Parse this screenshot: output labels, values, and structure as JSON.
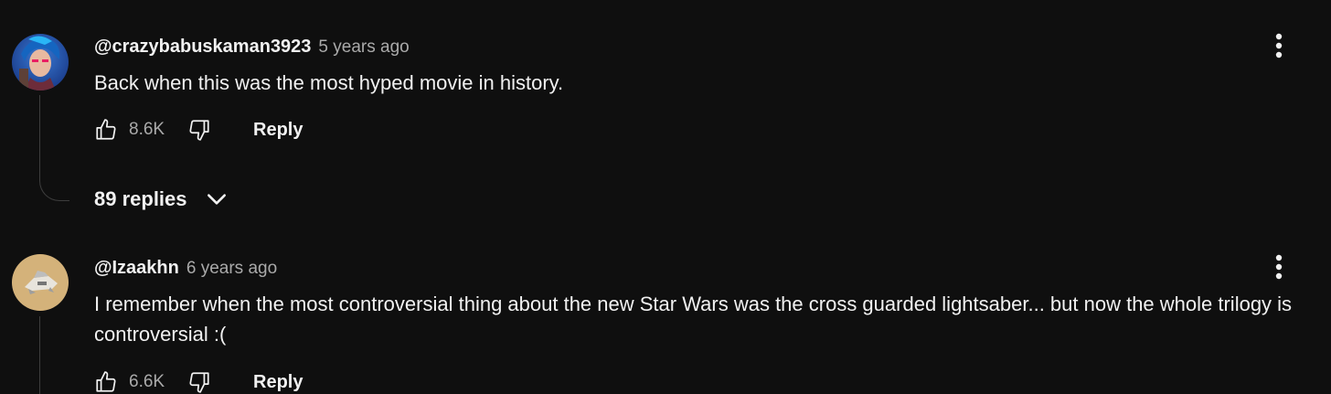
{
  "comments": [
    {
      "author": "@crazybabuskaman3923",
      "time": "5 years ago",
      "text": "Back when this was the most hyped movie in history.",
      "likes": "8.6K",
      "reply_label": "Reply",
      "replies_label": "89 replies",
      "avatar_icon": "avatar-blue-hair-character"
    },
    {
      "author": "@Izaakhn",
      "time": "6 years ago",
      "text": "I remember when the most controversial thing about the new Star Wars was the cross guarded lightsaber... but now the whole trilogy is controversial :(",
      "likes": "6.6K",
      "reply_label": "Reply",
      "avatar_icon": "avatar-ship-model"
    }
  ],
  "icons": {
    "like": "thumbs-up-icon",
    "dislike": "thumbs-down-icon",
    "more": "vertical-dots-icon",
    "expand": "chevron-down-icon"
  },
  "colors": {
    "background": "#0f0f0f",
    "text_primary": "#f1f1f1",
    "text_secondary": "#aaaaaa",
    "thread_line": "#3d3d3d"
  }
}
